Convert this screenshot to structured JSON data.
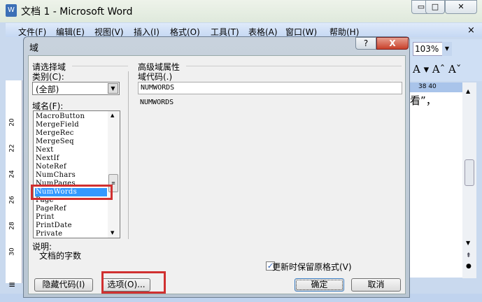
{
  "window": {
    "title": "文档 1 - Microsoft Word",
    "icon": "word-icon"
  },
  "menu": [
    "文件(F)",
    "编辑(E)",
    "视图(V)",
    "插入(I)",
    "格式(O)",
    "工具(T)",
    "表格(A)",
    "窗口(W)",
    "帮助(H)"
  ],
  "toolbar": {
    "zoom": "103%",
    "format_icons": "A ▾ Aˆ Aˇ"
  },
  "ruler": {
    "top_marks": "38  40",
    "left_marks": [
      "20",
      "22",
      "24",
      "26",
      "28",
      "30"
    ]
  },
  "document": {
    "visible_text": "看”，"
  },
  "dialog": {
    "title": "域",
    "help": "?",
    "close": "X",
    "left_group": "请选择域",
    "category_label": "类别(C):",
    "category_value": "(全部)",
    "field_names_label": "域名(F):",
    "field_names": [
      "MacroButton",
      "MergeField",
      "MergeRec",
      "MergeSeq",
      "Next",
      "NextIf",
      "NoteRef",
      "NumChars",
      "NumPages",
      "NumWords",
      "Page",
      "PageRef",
      "Print",
      "PrintDate",
      "Private"
    ],
    "selected_index": 9,
    "right_group": "高级域属性",
    "field_code_label": "域代码(.)",
    "field_code_value": "NUMWORDS",
    "field_code_preview": "NUMWORDS",
    "description_label": "说明:",
    "description": "文档的字数",
    "preserve_format_label": "更新时保留原格式(V)",
    "preserve_format_checked": true,
    "hide_codes_button": "隐藏代码(I)",
    "options_button": "选项(O)...",
    "ok_button": "确定",
    "cancel_button": "取消"
  },
  "colors": {
    "selection": "#3399ff",
    "highlight": "#d03030"
  }
}
